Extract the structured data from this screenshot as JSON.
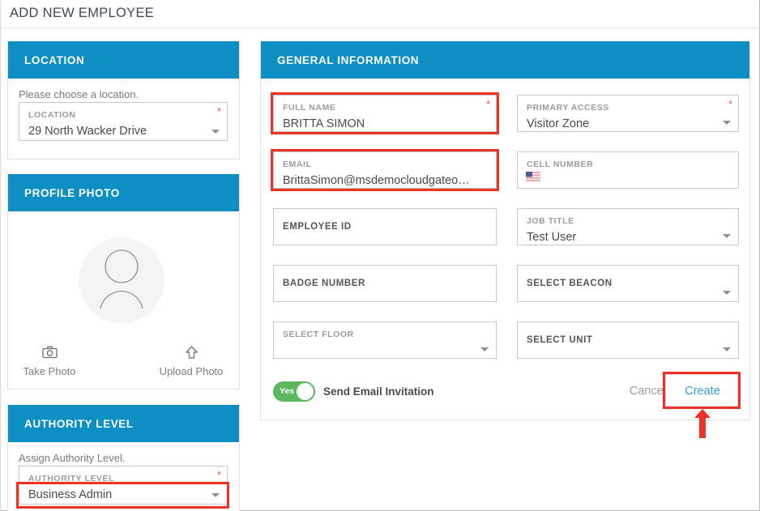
{
  "page": {
    "title": "ADD NEW EMPLOYEE",
    "accent_blue": "#0d8fc4",
    "highlight_red": "#ee3124",
    "link_blue": "#2e9fd8",
    "toggle_green": "#5cb85c"
  },
  "location_card": {
    "header": "LOCATION",
    "hint": "Please choose a location.",
    "field": {
      "label": "LOCATION",
      "value": "29 North Wacker Drive",
      "required": "*",
      "icon": "chevron-down-icon"
    }
  },
  "profile_card": {
    "header": "PROFILE PHOTO",
    "avatar_icon": "user-avatar-icon",
    "take_photo": {
      "label": "Take Photo",
      "icon": "camera-icon"
    },
    "upload_photo": {
      "label": "Upload Photo",
      "icon": "upload-arrow-icon"
    }
  },
  "authority_card": {
    "header": "AUTHORITY LEVEL",
    "hint": "Assign Authority Level.",
    "field": {
      "label": "AUTHORITY LEVEL",
      "value": "Business Admin",
      "required": "*",
      "icon": "chevron-down-icon"
    }
  },
  "general_card": {
    "header": "GENERAL INFORMATION",
    "fields": [
      {
        "name": "full-name",
        "label": "FULL NAME",
        "value": "BRITTA SIMON",
        "required": "*",
        "highlighted": true,
        "type": "text",
        "label_style": "float"
      },
      {
        "name": "primary-access",
        "label": "PRIMARY ACCESS",
        "value": "Visitor Zone",
        "required": "*",
        "highlighted": false,
        "type": "select",
        "label_style": "float"
      },
      {
        "name": "email",
        "label": "EMAIL",
        "value": "BrittaSimon@msdemocloudgateo…",
        "required": "",
        "highlighted": true,
        "type": "text",
        "label_style": "float"
      },
      {
        "name": "cell-number",
        "label": "CELL NUMBER",
        "value": "",
        "required": "",
        "highlighted": false,
        "type": "phone",
        "label_style": "float",
        "icon": "us-flag-icon"
      },
      {
        "name": "employee-id",
        "label": "EMPLOYEE ID",
        "value": "",
        "required": "",
        "highlighted": false,
        "type": "text",
        "label_style": "placeholder"
      },
      {
        "name": "job-title",
        "label": "JOB TITLE",
        "value": "Test User",
        "required": "",
        "highlighted": false,
        "type": "select",
        "label_style": "float"
      },
      {
        "name": "badge-number",
        "label": "BADGE NUMBER",
        "value": "",
        "required": "",
        "highlighted": false,
        "type": "text",
        "label_style": "placeholder"
      },
      {
        "name": "select-beacon",
        "label": "SELECT BEACON",
        "value": "",
        "required": "",
        "highlighted": false,
        "type": "select",
        "label_style": "placeholder"
      },
      {
        "name": "select-floor",
        "label": "SELECT FLOOR",
        "value": "",
        "required": "",
        "highlighted": false,
        "type": "select",
        "label_style": "float"
      },
      {
        "name": "select-unit",
        "label": "SELECT UNIT",
        "value": "",
        "required": "",
        "highlighted": false,
        "type": "select",
        "label_style": "placeholder"
      }
    ],
    "toggle": {
      "state_label": "Yes",
      "caption": "Send Email Invitation",
      "on": true
    },
    "cancel_label": "Cancel",
    "create_label": "Create",
    "create_highlighted": true,
    "pointer_icon": "up-arrow-annotation"
  }
}
